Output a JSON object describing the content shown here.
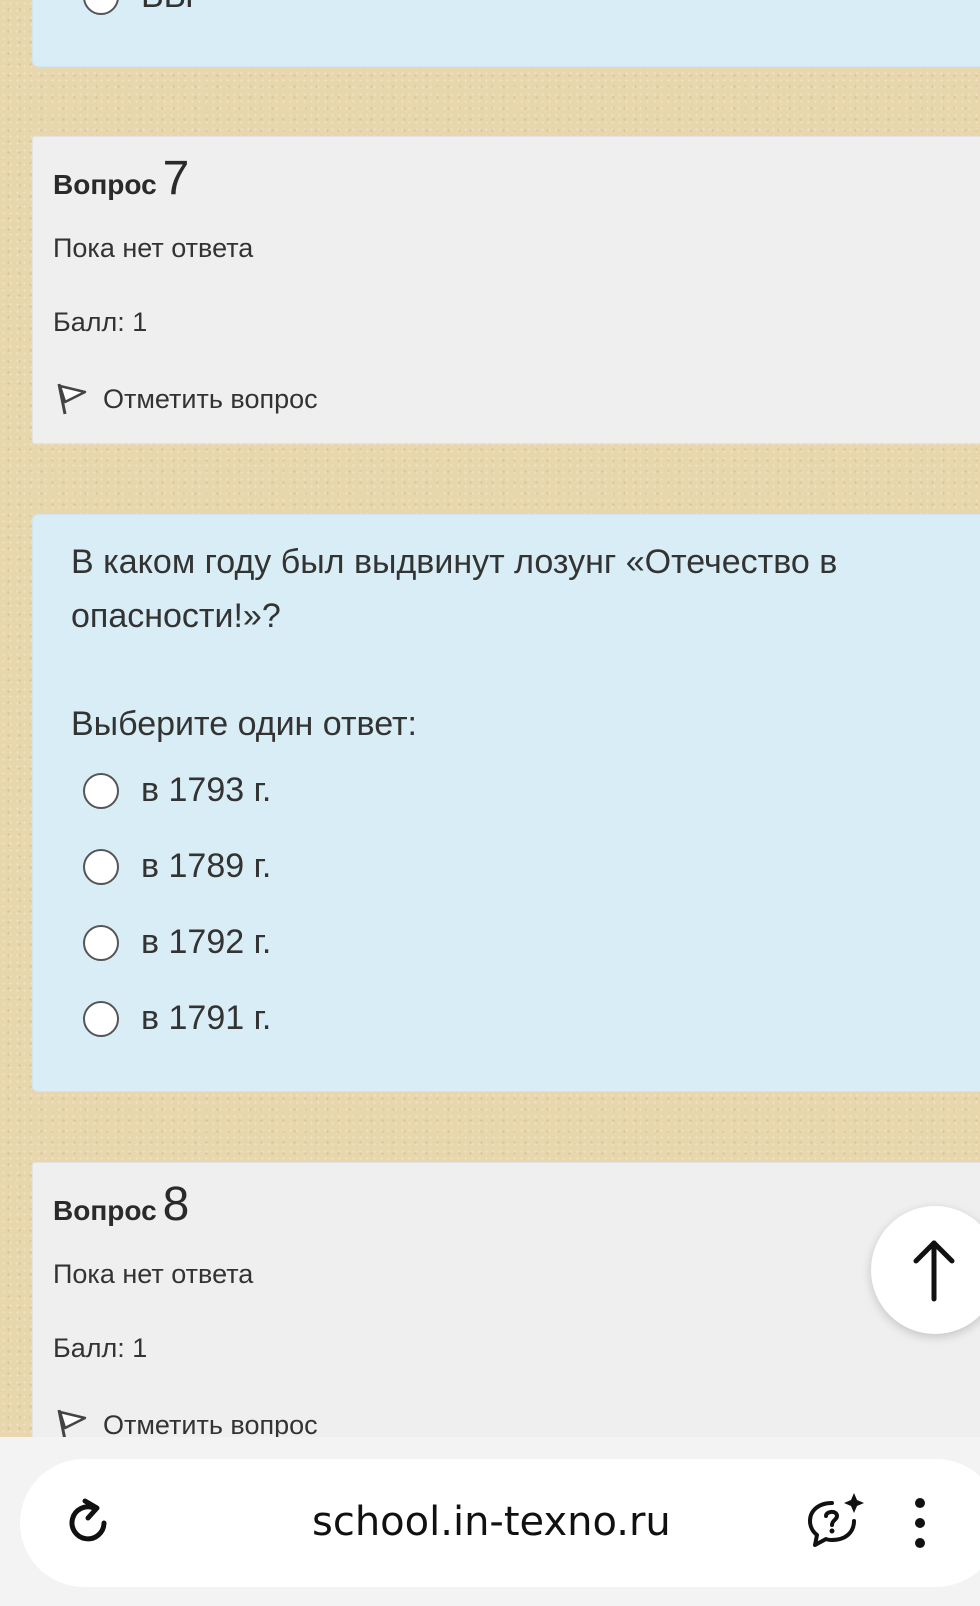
{
  "prev_question": {
    "partial_label": "ВЫ"
  },
  "q7": {
    "word": "Вопрос",
    "number": "7",
    "state": "Пока нет ответа",
    "grade": "Балл: 1",
    "flag_label": "Отметить вопрос"
  },
  "q7_content": {
    "text": "В каком году был выдвинут лозунг «Отечество в опасности!»?",
    "prompt": "Выберите один ответ:",
    "answers": [
      "в 1793 г.",
      "в 1789 г.",
      "в 1792 г.",
      "в 1791 г."
    ]
  },
  "q8": {
    "word": "Вопрос",
    "number": "8",
    "state": "Пока нет ответа",
    "grade": "Балл: 1",
    "flag_label": "Отметить вопрос"
  },
  "browser": {
    "url": "school.in-texno.ru"
  },
  "icons": [
    "radio-icon",
    "flag-icon",
    "arrow-up-icon",
    "reload-icon",
    "chat-sparkle-icon",
    "more-vertical-icon"
  ]
}
